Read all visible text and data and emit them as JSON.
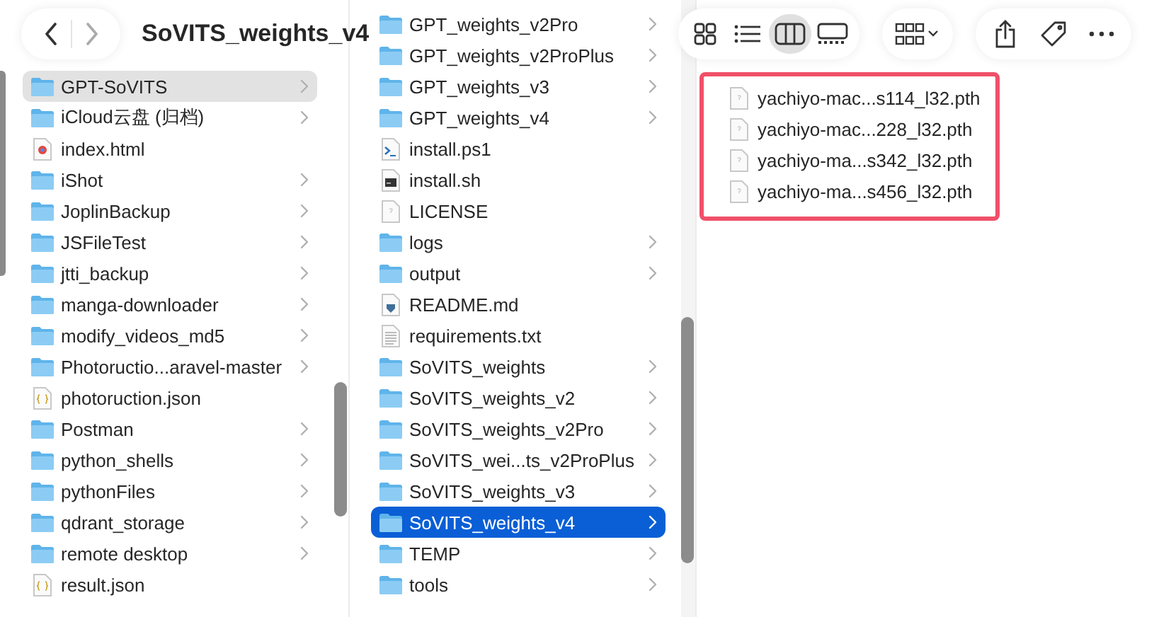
{
  "window": {
    "title": "SoVITS_weights_v4"
  },
  "columns": [
    {
      "focused": false,
      "items": [
        {
          "name": "GPT-SoVITS",
          "kind": "folder",
          "selected": true
        },
        {
          "name": "iCloud云盘 (归档)",
          "kind": "folder",
          "selected": false
        },
        {
          "name": "index.html",
          "kind": "html",
          "selected": false
        },
        {
          "name": "iShot",
          "kind": "folder",
          "selected": false
        },
        {
          "name": "JoplinBackup",
          "kind": "folder",
          "selected": false
        },
        {
          "name": "JSFileTest",
          "kind": "folder",
          "selected": false
        },
        {
          "name": "jtti_backup",
          "kind": "folder",
          "selected": false
        },
        {
          "name": "manga-downloader",
          "kind": "folder",
          "selected": false
        },
        {
          "name": "modify_videos_md5",
          "kind": "folder",
          "selected": false
        },
        {
          "name": "Photoructio...aravel-master",
          "kind": "folder",
          "selected": false
        },
        {
          "name": "photoruction.json",
          "kind": "json",
          "selected": false
        },
        {
          "name": "Postman",
          "kind": "folder",
          "selected": false
        },
        {
          "name": "python_shells",
          "kind": "folder",
          "selected": false
        },
        {
          "name": "pythonFiles",
          "kind": "folder",
          "selected": false
        },
        {
          "name": "qdrant_storage",
          "kind": "folder",
          "selected": false
        },
        {
          "name": "remote desktop",
          "kind": "folder",
          "selected": false
        },
        {
          "name": "result.json",
          "kind": "json",
          "selected": false
        }
      ]
    },
    {
      "focused": true,
      "items": [
        {
          "name": "GPT_weights_v2Pro",
          "kind": "folder",
          "selected": false
        },
        {
          "name": "GPT_weights_v2ProPlus",
          "kind": "folder",
          "selected": false
        },
        {
          "name": "GPT_weights_v3",
          "kind": "folder",
          "selected": false
        },
        {
          "name": "GPT_weights_v4",
          "kind": "folder",
          "selected": false
        },
        {
          "name": "install.ps1",
          "kind": "script",
          "selected": false
        },
        {
          "name": "install.sh",
          "kind": "shell",
          "selected": false
        },
        {
          "name": "LICENSE",
          "kind": "generic",
          "selected": false
        },
        {
          "name": "logs",
          "kind": "folder",
          "selected": false
        },
        {
          "name": "output",
          "kind": "folder",
          "selected": false
        },
        {
          "name": "README.md",
          "kind": "markdown",
          "selected": false
        },
        {
          "name": "requirements.txt",
          "kind": "text",
          "selected": false
        },
        {
          "name": "SoVITS_weights",
          "kind": "folder",
          "selected": false
        },
        {
          "name": "SoVITS_weights_v2",
          "kind": "folder",
          "selected": false
        },
        {
          "name": "SoVITS_weights_v2Pro",
          "kind": "folder",
          "selected": false
        },
        {
          "name": "SoVITS_wei...ts_v2ProPlus",
          "kind": "folder",
          "selected": false
        },
        {
          "name": "SoVITS_weights_v3",
          "kind": "folder",
          "selected": false
        },
        {
          "name": "SoVITS_weights_v4",
          "kind": "folder",
          "selected": true
        },
        {
          "name": "TEMP",
          "kind": "folder",
          "selected": false
        },
        {
          "name": "tools",
          "kind": "folder",
          "selected": false
        }
      ]
    },
    {
      "highlighted": true,
      "items": [
        {
          "name": "yachiyo-mac...s114_l32.pth",
          "kind": "generic",
          "selected": false
        },
        {
          "name": "yachiyo-mac...228_l32.pth",
          "kind": "generic",
          "selected": false
        },
        {
          "name": "yachiyo-ma...s342_l32.pth",
          "kind": "generic",
          "selected": false
        },
        {
          "name": "yachiyo-ma...s456_l32.pth",
          "kind": "generic",
          "selected": false
        }
      ]
    }
  ]
}
